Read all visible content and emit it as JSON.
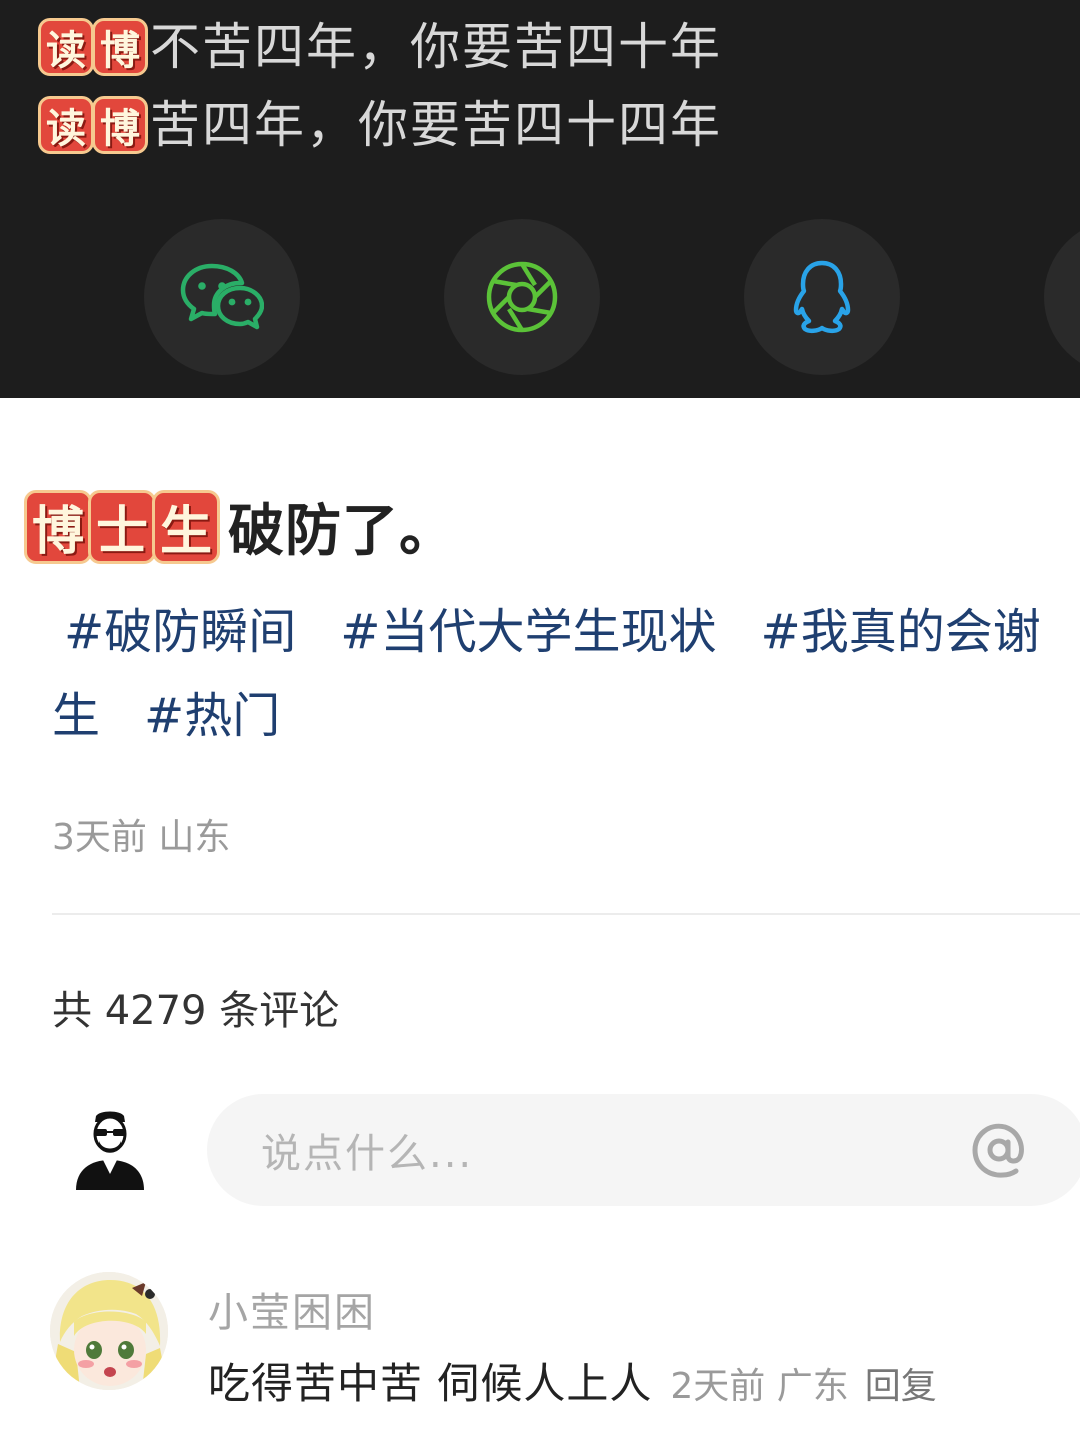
{
  "share_sheet": {
    "lines": [
      {
        "badge": [
          "读",
          "博"
        ],
        "text": "不苦四年，你要苦四十年"
      },
      {
        "badge": [
          "读",
          "博"
        ],
        "text": "苦四年，你要苦四十四年"
      }
    ],
    "icons": [
      "wechat-icon",
      "moments-icon",
      "qq-icon",
      "more-icon"
    ],
    "colors": {
      "wechat": "#2aae67",
      "moments": "#5bc238",
      "qq": "#29a3e8"
    }
  },
  "post": {
    "title_badge": [
      "博",
      "士",
      "生"
    ],
    "title_text": "破防了。",
    "tags": [
      "#破防瞬间",
      "#当代大学生现状",
      "#我真的会谢",
      "生",
      "#热门"
    ],
    "meta": "3天前 山东"
  },
  "comments": {
    "count_label": "共 4279 条评论",
    "input_placeholder": "说点什么...",
    "items": [
      {
        "name": "小莹困困",
        "text": "吃得苦中苦 伺候人上人",
        "time_location": "2天前 广东",
        "reply_label": "回复"
      }
    ]
  }
}
